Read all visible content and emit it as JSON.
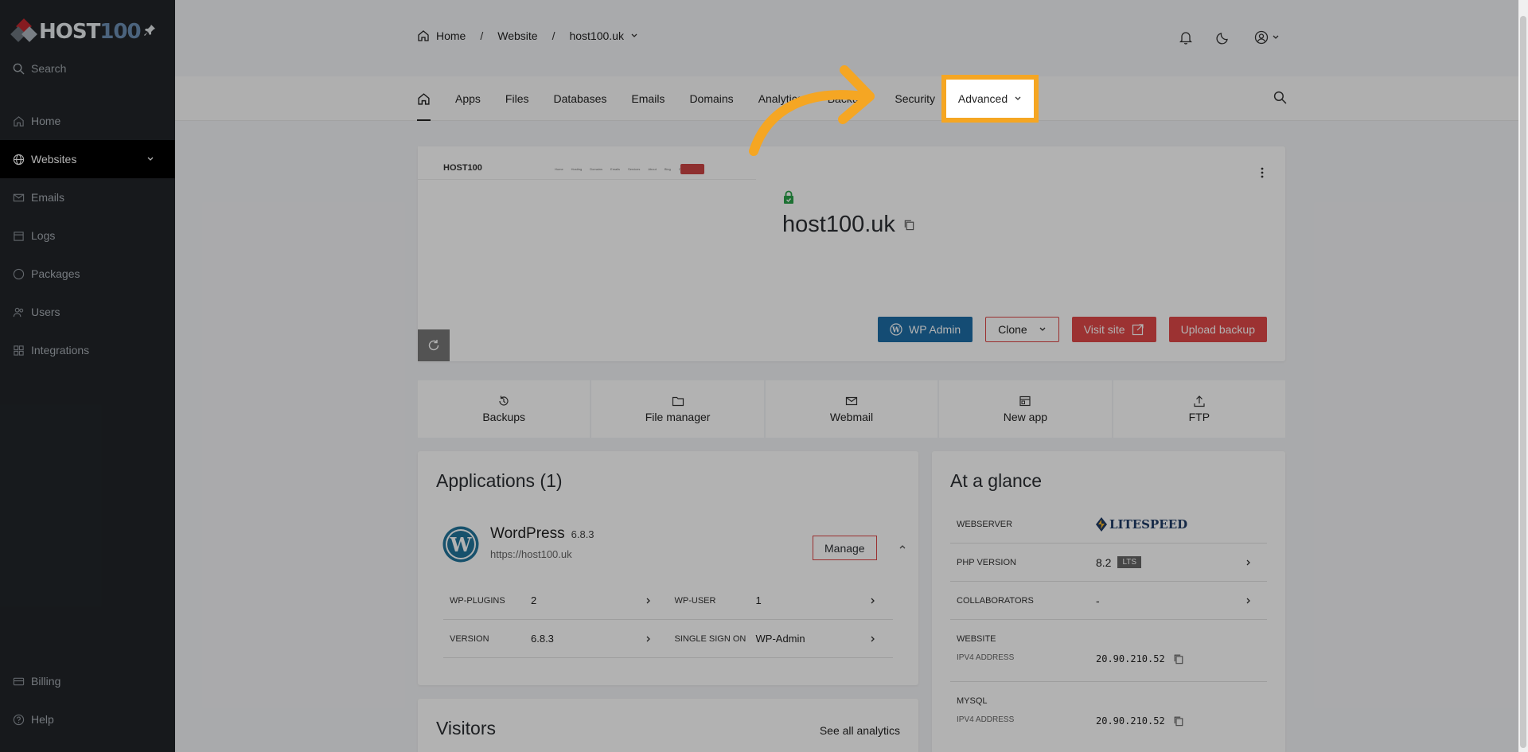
{
  "sidebar": {
    "logo": {
      "word": "HOST",
      "number": "100"
    },
    "search_label": "Search",
    "items": [
      {
        "label": "Home",
        "icon": "home-icon"
      },
      {
        "label": "Websites",
        "icon": "globe-icon",
        "active": true
      },
      {
        "label": "Emails",
        "icon": "mail-icon"
      },
      {
        "label": "Logs",
        "icon": "calendar-icon"
      },
      {
        "label": "Packages",
        "icon": "circle-icon"
      },
      {
        "label": "Users",
        "icon": "users-icon"
      },
      {
        "label": "Integrations",
        "icon": "grid-icon"
      }
    ],
    "bottom_items": [
      {
        "label": "Billing",
        "icon": "billing-icon"
      },
      {
        "label": "Help",
        "icon": "help-icon"
      }
    ]
  },
  "breadcrumb": {
    "home": "Home",
    "section": "Website",
    "site": "host100.uk"
  },
  "tabs": [
    "Apps",
    "Files",
    "Databases",
    "Emails",
    "Domains",
    "Analytics",
    "Backups",
    "Security"
  ],
  "highlighted_tab": "Advanced",
  "preview": {
    "logo": "HOST100",
    "links": [
      "Home",
      "Hosting",
      "Domains",
      "Emails",
      "Services",
      "About",
      "Blog",
      "Contact"
    ]
  },
  "site": {
    "domain": "host100.uk"
  },
  "hero_buttons": {
    "wp_admin": "WP Admin",
    "clone": "Clone",
    "visit": "Visit site",
    "upload": "Upload backup"
  },
  "quick_actions": [
    {
      "label": "Backups",
      "icon": "backup-icon"
    },
    {
      "label": "File manager",
      "icon": "folder-icon"
    },
    {
      "label": "Webmail",
      "icon": "mail-icon"
    },
    {
      "label": "New app",
      "icon": "app-icon"
    },
    {
      "label": "FTP",
      "icon": "upload-icon"
    }
  ],
  "applications": {
    "title": "Applications (1)",
    "app": {
      "name": "WordPress",
      "version": "6.8.3",
      "url": "https://host100.uk",
      "manage_label": "Manage"
    },
    "details": [
      [
        {
          "key": "WP-PLUGINS",
          "value": "2"
        },
        {
          "key": "WP-USER",
          "value": "1"
        }
      ],
      [
        {
          "key": "VERSION",
          "value": "6.8.3"
        },
        {
          "key": "SINGLE SIGN ON",
          "value": "WP-Admin"
        }
      ]
    ]
  },
  "glance": {
    "title": "At a glance",
    "webserver_key": "WEBSERVER",
    "webserver_value": "LITESPEED",
    "php_key": "PHP VERSION",
    "php_value": "8.2",
    "php_badge": "LTS",
    "collab_key": "COLLABORATORS",
    "collab_value": "-",
    "website_key": "WEBSITE",
    "website_sub": "IPV4 ADDRESS",
    "website_ip": "20.90.210.52",
    "mysql_key": "MYSQL",
    "mysql_sub": "IPV4 ADDRESS",
    "mysql_ip": "20.90.210.52"
  },
  "visitors": {
    "title": "Visitors",
    "link": "See all analytics"
  },
  "colors": {
    "highlight": "#f5a623",
    "wp_blue": "#1e6ea6",
    "danger": "#e04848",
    "sidebar": "#212529"
  }
}
